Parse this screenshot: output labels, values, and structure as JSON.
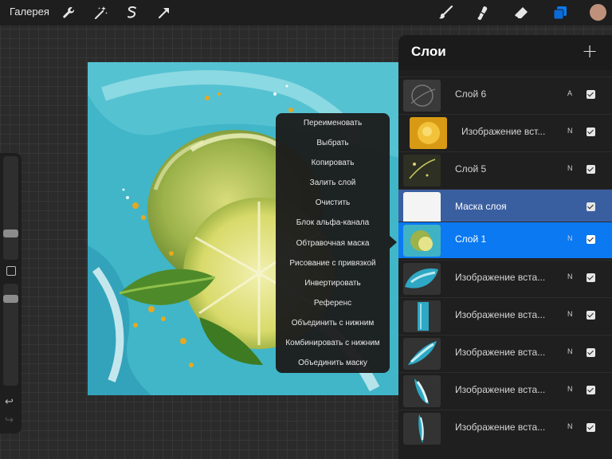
{
  "toolbar": {
    "gallery_label": "Галерея",
    "left_tools": [
      "wrench-icon",
      "magic-wand-icon",
      "selection-icon",
      "transform-arrow-icon"
    ],
    "right_tools": [
      "brush-icon",
      "smudge-icon",
      "eraser-icon",
      "layers-icon",
      "color-swatch"
    ],
    "color_swatch": "#c0917a",
    "active_accent": "#0a79f2"
  },
  "sidebar": {
    "undo_icon": "↩",
    "redo_icon": "↪"
  },
  "context_menu": {
    "items": [
      "Переименовать",
      "Выбрать",
      "Копировать",
      "Залить слой",
      "Очистить",
      "Блок альфа-канала",
      "Обтравочная маска",
      "Рисование с привязкой",
      "Инвертировать",
      "Референс",
      "Объединить с нижним",
      "Комбинировать с нижним",
      "Объединить маску"
    ]
  },
  "layers_panel": {
    "title": "Слои",
    "add_icon": "+",
    "layers": [
      {
        "name": "Слой 6",
        "blend": "A",
        "visible": true,
        "state": "normal"
      },
      {
        "name": "Изображение вст...",
        "blend": "N",
        "visible": true,
        "state": "normal"
      },
      {
        "name": "Слой 5",
        "blend": "N",
        "visible": true,
        "state": "normal"
      },
      {
        "name": "Маска слоя",
        "blend": "",
        "visible": true,
        "state": "mask"
      },
      {
        "name": "Слой 1",
        "blend": "N",
        "visible": true,
        "state": "active"
      },
      {
        "name": "Изображение вста...",
        "blend": "N",
        "visible": true,
        "state": "normal"
      },
      {
        "name": "Изображение вста...",
        "blend": "N",
        "visible": true,
        "state": "normal"
      },
      {
        "name": "Изображение вста...",
        "blend": "N",
        "visible": true,
        "state": "normal"
      },
      {
        "name": "Изображение вста...",
        "blend": "N",
        "visible": true,
        "state": "normal"
      },
      {
        "name": "Изображение вста...",
        "blend": "N",
        "visible": true,
        "state": "normal"
      }
    ]
  }
}
